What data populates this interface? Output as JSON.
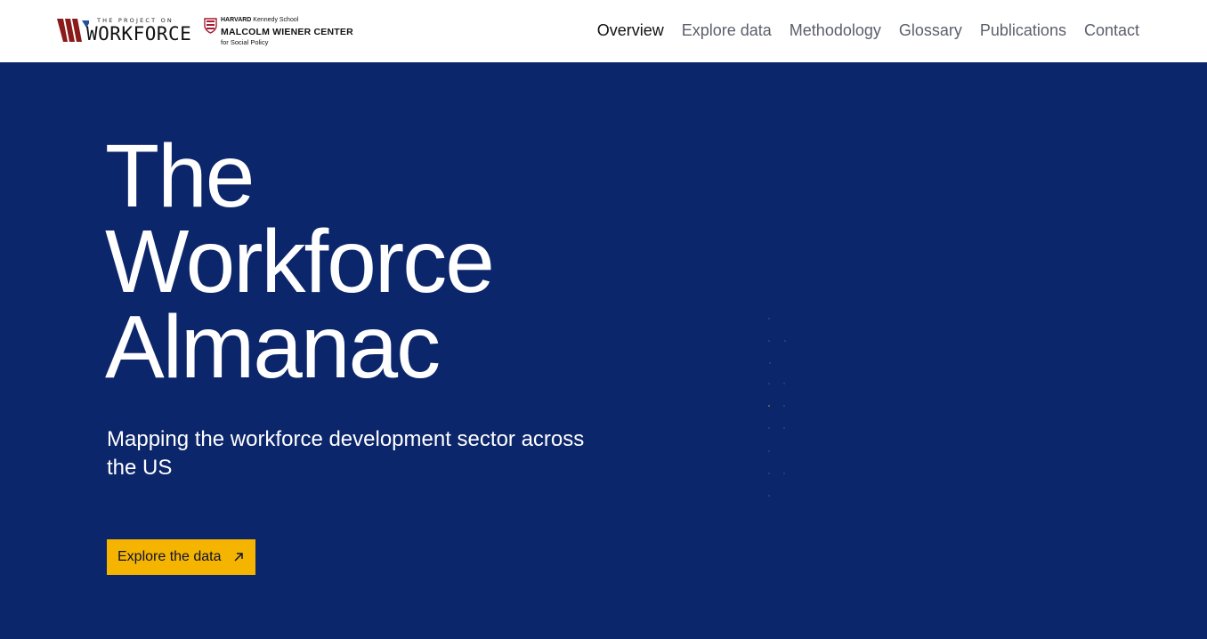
{
  "header": {
    "logo_project": {
      "small_text": "THE PROJECT ON",
      "big_text": "WORKFORCE",
      "brand_colors": [
        "#8b1a1a",
        "#1f4fa0"
      ]
    },
    "logo_hks": {
      "line1_bold": "HARVARD",
      "line1_rest": " Kennedy School",
      "line2": "MALCOLM WIENER CENTER",
      "line3": "for Social Policy",
      "shield_color": "#a51c30"
    },
    "nav": [
      {
        "label": "Overview",
        "active": true
      },
      {
        "label": "Explore data",
        "active": false
      },
      {
        "label": "Methodology",
        "active": false
      },
      {
        "label": "Glossary",
        "active": false
      },
      {
        "label": "Publications",
        "active": false
      },
      {
        "label": "Contact",
        "active": false
      }
    ]
  },
  "hero": {
    "title_lines": [
      "The",
      "Workforce",
      "Almanac"
    ],
    "subtitle": "Mapping the workforce development sector across the US",
    "cta_label": "Explore the data",
    "cta_icon": "arrow-up-right-icon",
    "background_color": "#0c266b",
    "cta_color": "#f5b400"
  }
}
